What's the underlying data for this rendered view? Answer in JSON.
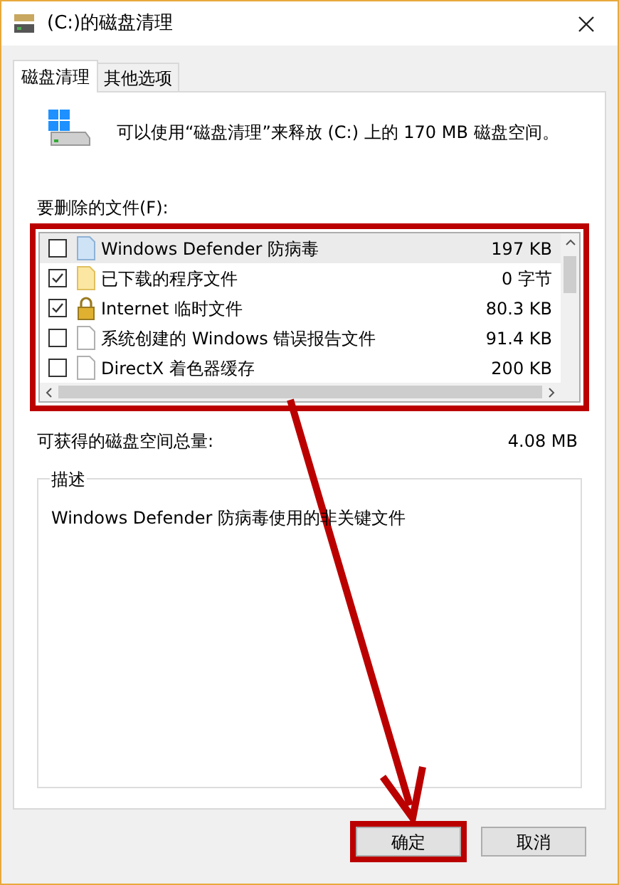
{
  "window": {
    "title": "(C:)的磁盘清理"
  },
  "tabs": [
    {
      "label": "磁盘清理",
      "selected": true
    },
    {
      "label": "其他选项",
      "selected": false
    }
  ],
  "intro": "可以使用“磁盘清理”来释放 (C:) 上的 170 MB 磁盘空间。",
  "files_label": "要删除的文件(F):",
  "files": [
    {
      "kind": "defender",
      "name": "Windows Defender 防病毒",
      "size": "197 KB",
      "checked": false,
      "selected": true
    },
    {
      "kind": "folder",
      "name": "已下载的程序文件",
      "size": "0 字节",
      "checked": true,
      "selected": false
    },
    {
      "kind": "lock",
      "name": "Internet 临时文件",
      "size": "80.3 KB",
      "checked": true,
      "selected": false
    },
    {
      "kind": "document",
      "name": "系统创建的 Windows 错误报告文件",
      "size": "91.4 KB",
      "checked": false,
      "selected": false
    },
    {
      "kind": "document",
      "name": "DirectX 着色器缓存",
      "size": "200 KB",
      "checked": false,
      "selected": false
    }
  ],
  "total": {
    "label": "可获得的磁盘空间总量:",
    "value": "4.08 MB"
  },
  "description": {
    "title": "描述",
    "text": "Windows Defender 防病毒使用的非关键文件"
  },
  "buttons": [
    {
      "label": "确定",
      "highlighted": true
    },
    {
      "label": "取消",
      "highlighted": false
    }
  ]
}
